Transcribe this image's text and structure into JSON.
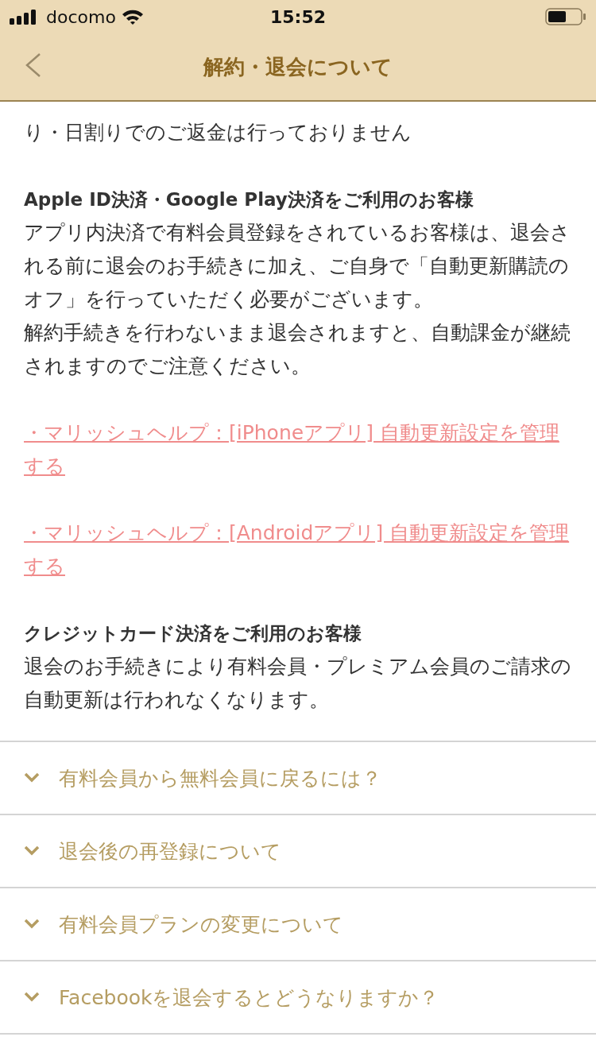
{
  "status_bar": {
    "carrier": "docomo",
    "time": "15:52"
  },
  "header": {
    "title": "解約・退会について"
  },
  "intro_tail": "り・日割りでのご返金は行っておりません",
  "sections": [
    {
      "heading": "Apple ID決済・Google Play決済をご利用のお客様",
      "paragraphs": [
        "アプリ内決済で有料会員登録をされているお客様は、退会される前に退会のお手続きに加え、ご自身で「自動更新購読のオフ」を行っていただく必要がございます。",
        "解約手続きを行わないまま退会されますと、自動課金が継続されますのでご注意ください。"
      ],
      "links": [
        "・マリッシュヘルプ：[iPhoneアプリ] 自動更新設定を管理する",
        "・マリッシュヘルプ：[Androidアプリ] 自動更新設定を管理する"
      ]
    },
    {
      "heading": "クレジットカード決済をご利用のお客様",
      "paragraphs": [
        "退会のお手続きにより有料会員・プレミアム会員のご請求の自動更新は行われなくなります。"
      ]
    }
  ],
  "faq": [
    {
      "question": "有料会員から無料会員に戻るには？",
      "expanded": false
    },
    {
      "question": "退会後の再登録について",
      "expanded": false
    },
    {
      "question": "有料会員プランの変更について",
      "expanded": false
    },
    {
      "question": "Facebookを退会するとどうなりますか？",
      "expanded": false
    }
  ]
}
